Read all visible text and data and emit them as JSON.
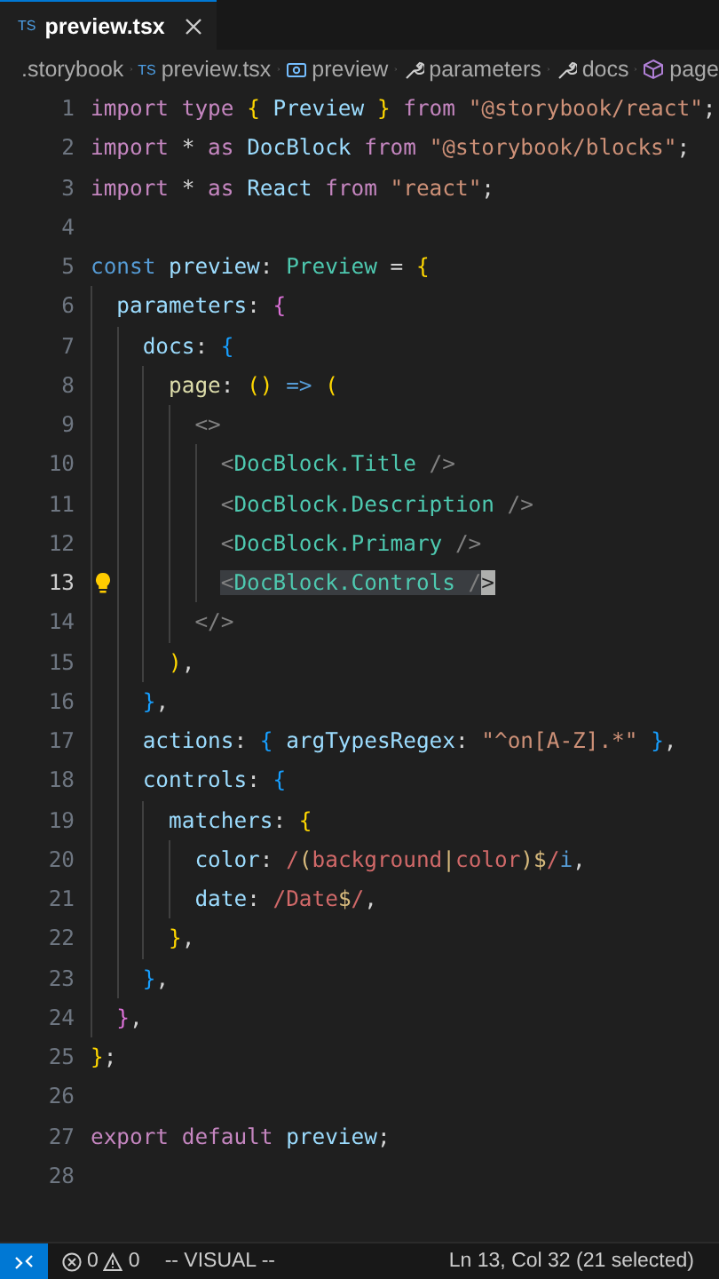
{
  "tabs": [
    {
      "badge": "TS",
      "label": "preview.tsx",
      "selected": true
    }
  ],
  "breadcrumbs": [
    {
      "label": ".storybook",
      "kind": "folder"
    },
    {
      "label": "preview.tsx",
      "kind": "file",
      "badge": "TS"
    },
    {
      "label": "preview",
      "kind": "variable"
    },
    {
      "label": "parameters",
      "kind": "property"
    },
    {
      "label": "docs",
      "kind": "property"
    },
    {
      "label": "page",
      "kind": "method"
    }
  ],
  "editor": {
    "lines": [
      {
        "number": "1",
        "current": false,
        "tokens": [
          {
            "text": "import type ",
            "kind": "kw"
          },
          {
            "text": "{",
            "kind": "b1"
          },
          {
            "text": " Preview ",
            "kind": "var"
          },
          {
            "text": "}",
            "kind": "b1"
          },
          {
            "text": " from ",
            "kind": "kw"
          },
          {
            "text": "\"@storybook/react\"",
            "kind": "str"
          },
          {
            "text": ";",
            "kind": "p"
          }
        ]
      },
      {
        "number": "2",
        "current": false,
        "tokens": [
          {
            "text": "import",
            "kind": "kw"
          },
          {
            "text": " * ",
            "kind": "p"
          },
          {
            "text": "as",
            "kind": "kw"
          },
          {
            "text": " DocBlock",
            "kind": "var"
          },
          {
            "text": " from ",
            "kind": "kw"
          },
          {
            "text": "\"@storybook/blocks\"",
            "kind": "str"
          },
          {
            "text": ";",
            "kind": "p"
          }
        ]
      },
      {
        "number": "3",
        "current": false,
        "tokens": [
          {
            "text": "import",
            "kind": "kw"
          },
          {
            "text": " * ",
            "kind": "p"
          },
          {
            "text": "as",
            "kind": "kw"
          },
          {
            "text": " React",
            "kind": "var"
          },
          {
            "text": " from ",
            "kind": "kw"
          },
          {
            "text": "\"react\"",
            "kind": "str"
          },
          {
            "text": ";",
            "kind": "p"
          }
        ]
      },
      {
        "number": "4",
        "current": false
      },
      {
        "number": "5",
        "current": false,
        "tokens": [
          {
            "text": "const",
            "kind": "storage"
          },
          {
            "text": " preview",
            "kind": "var"
          },
          {
            "text": ": ",
            "kind": "p"
          },
          {
            "text": "Preview",
            "kind": "type"
          },
          {
            "text": " = ",
            "kind": "p"
          },
          {
            "text": "{",
            "kind": "b1"
          }
        ]
      },
      {
        "number": "6",
        "current": false,
        "tokens": [
          {
            "text": "  parameters",
            "kind": "var"
          },
          {
            "text": ": ",
            "kind": "p"
          },
          {
            "text": "{",
            "kind": "b2"
          }
        ]
      },
      {
        "number": "7",
        "current": false,
        "tokens": [
          {
            "text": "    docs",
            "kind": "var"
          },
          {
            "text": ": ",
            "kind": "p"
          },
          {
            "text": "{",
            "kind": "b3"
          }
        ]
      },
      {
        "number": "8",
        "current": false,
        "tokens": [
          {
            "text": "      page",
            "kind": "fn"
          },
          {
            "text": ": ",
            "kind": "p"
          },
          {
            "text": "()",
            "kind": "b1"
          },
          {
            "text": " => ",
            "kind": "storage"
          },
          {
            "text": "(",
            "kind": "b1"
          }
        ]
      },
      {
        "number": "9",
        "current": false,
        "tokens": [
          {
            "text": "        <>",
            "kind": "tag"
          }
        ]
      },
      {
        "number": "10",
        "current": false,
        "tokens": [
          {
            "text": "          <",
            "kind": "tag"
          },
          {
            "text": "DocBlock.Title",
            "kind": "type"
          },
          {
            "text": " />",
            "kind": "tag"
          }
        ]
      },
      {
        "number": "11",
        "current": false,
        "tokens": [
          {
            "text": "          <",
            "kind": "tag"
          },
          {
            "text": "DocBlock.Description",
            "kind": "type"
          },
          {
            "text": " />",
            "kind": "tag"
          }
        ]
      },
      {
        "number": "12",
        "current": false,
        "tokens": [
          {
            "text": "          <",
            "kind": "tag"
          },
          {
            "text": "DocBlock.Primary",
            "kind": "type"
          },
          {
            "text": " />",
            "kind": "tag"
          }
        ]
      },
      {
        "number": "13",
        "current": true,
        "lightbulb": true,
        "tokens": [
          {
            "kind": "selection",
            "tokens": [
              {
                "text": "          <",
                "kind": "tag"
              },
              {
                "text": "DocBlock.Controls",
                "kind": "type"
              },
              {
                "text": " /",
                "kind": "tag"
              },
              {
                "text": ">",
                "kind": "cursor"
              }
            ]
          }
        ]
      },
      {
        "number": "14",
        "current": false,
        "tokens": [
          {
            "text": "        </>",
            "kind": "tag"
          }
        ]
      },
      {
        "number": "15",
        "current": false,
        "tokens": [
          {
            "text": "      )",
            "kind": "b1"
          },
          {
            "text": ",",
            "kind": "p"
          }
        ]
      },
      {
        "number": "16",
        "current": false,
        "tokens": [
          {
            "text": "    }",
            "kind": "b3"
          },
          {
            "text": ",",
            "kind": "p"
          }
        ]
      },
      {
        "number": "17",
        "current": false,
        "tokens": [
          {
            "text": "    actions",
            "kind": "var"
          },
          {
            "text": ": ",
            "kind": "p"
          },
          {
            "text": "{",
            "kind": "b3"
          },
          {
            "text": " argTypesRegex",
            "kind": "var"
          },
          {
            "text": ": ",
            "kind": "p"
          },
          {
            "text": "\"^on[A-Z].*\"",
            "kind": "str"
          },
          {
            "text": " }",
            "kind": "b3"
          },
          {
            "text": ",",
            "kind": "p"
          }
        ]
      },
      {
        "number": "18",
        "current": false,
        "tokens": [
          {
            "text": "    controls",
            "kind": "var"
          },
          {
            "text": ": ",
            "kind": "p"
          },
          {
            "text": "{",
            "kind": "b3"
          }
        ]
      },
      {
        "number": "19",
        "current": false,
        "tokens": [
          {
            "text": "      matchers",
            "kind": "var"
          },
          {
            "text": ": ",
            "kind": "p"
          },
          {
            "text": "{",
            "kind": "b1"
          }
        ]
      },
      {
        "number": "20",
        "current": false,
        "tokens": [
          {
            "text": "        color",
            "kind": "var"
          },
          {
            "text": ": ",
            "kind": "p"
          },
          {
            "text": "/",
            "kind": "regex"
          },
          {
            "text": "(",
            "kind": "rop"
          },
          {
            "text": "background",
            "kind": "regex"
          },
          {
            "text": "|",
            "kind": "rop"
          },
          {
            "text": "color",
            "kind": "regex"
          },
          {
            "text": ")$",
            "kind": "rop"
          },
          {
            "text": "/",
            "kind": "regex"
          },
          {
            "text": "i",
            "kind": "storage"
          },
          {
            "text": ",",
            "kind": "p"
          }
        ]
      },
      {
        "number": "21",
        "current": false,
        "tokens": [
          {
            "text": "        date",
            "kind": "var"
          },
          {
            "text": ": ",
            "kind": "p"
          },
          {
            "text": "/Date",
            "kind": "regex"
          },
          {
            "text": "$",
            "kind": "rop"
          },
          {
            "text": "/",
            "kind": "regex"
          },
          {
            "text": ",",
            "kind": "p"
          }
        ]
      },
      {
        "number": "22",
        "current": false,
        "tokens": [
          {
            "text": "      }",
            "kind": "b1"
          },
          {
            "text": ",",
            "kind": "p"
          }
        ]
      },
      {
        "number": "23",
        "current": false,
        "tokens": [
          {
            "text": "    }",
            "kind": "b3"
          },
          {
            "text": ",",
            "kind": "p"
          }
        ]
      },
      {
        "number": "24",
        "current": false,
        "tokens": [
          {
            "text": "  }",
            "kind": "b2"
          },
          {
            "text": ",",
            "kind": "p"
          }
        ]
      },
      {
        "number": "25",
        "current": false,
        "tokens": [
          {
            "text": "}",
            "kind": "b1"
          },
          {
            "text": ";",
            "kind": "p"
          }
        ]
      },
      {
        "number": "26",
        "current": false
      },
      {
        "number": "27",
        "current": false,
        "tokens": [
          {
            "text": "export default ",
            "kind": "kw"
          },
          {
            "text": "preview",
            "kind": "var"
          },
          {
            "text": ";",
            "kind": "p"
          }
        ]
      },
      {
        "number": "28",
        "current": false
      }
    ]
  },
  "status_bar": {
    "errors": "0",
    "warnings": "0",
    "mode": "-- VISUAL --",
    "position": "Ln 13, Col 32 (21 selected)"
  }
}
